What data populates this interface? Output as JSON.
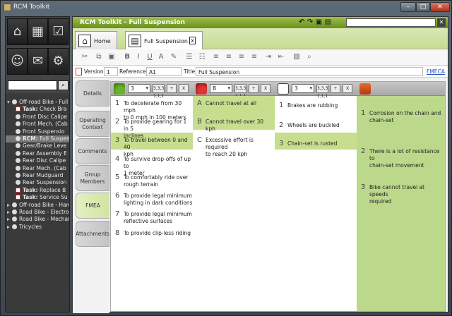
{
  "window": {
    "title": "RCM Toolkit"
  },
  "tree": [
    {
      "text": "Off-road Bike - Full S",
      "level": 0,
      "expanded": true,
      "icon": "gear-icon",
      "task": false
    },
    {
      "text": "Task: Check Bra",
      "level": 1,
      "icon": "task-icon",
      "task": true
    },
    {
      "text": "Front Disc Calipe",
      "level": 1,
      "icon": "gear-icon",
      "task": false
    },
    {
      "text": "Front Mech. (Cab",
      "level": 1,
      "icon": "gear-icon",
      "task": false
    },
    {
      "text": "Front Suspensio",
      "level": 1,
      "icon": "gear-icon",
      "task": false
    },
    {
      "text": "RCM: Full Suspen",
      "level": 1,
      "icon": "rcm-icon",
      "task": false,
      "selected": true
    },
    {
      "text": "Gear/Brake Leve",
      "level": 1,
      "icon": "gear-icon",
      "task": false
    },
    {
      "text": "Rear Assembly E",
      "level": 1,
      "icon": "gear-icon",
      "task": false
    },
    {
      "text": "Rear Disc Calipe",
      "level": 1,
      "icon": "gear-icon",
      "task": false
    },
    {
      "text": "Rear Mech. (Cab",
      "level": 1,
      "icon": "gear-icon",
      "task": false
    },
    {
      "text": "Rear Mudguard",
      "level": 1,
      "icon": "gear-icon",
      "task": false
    },
    {
      "text": "Rear Suspension",
      "level": 1,
      "icon": "gear-icon",
      "task": false
    },
    {
      "text": "Task: Replace B",
      "level": 1,
      "icon": "task-icon",
      "task": true
    },
    {
      "text": "Task: Service Su",
      "level": 1,
      "icon": "task-icon",
      "task": true
    },
    {
      "text": "Off-road Bike - Hardt",
      "level": 0,
      "expanded": false,
      "icon": "gear-icon",
      "task": false
    },
    {
      "text": "Road Bike - Electron",
      "level": 0,
      "expanded": false,
      "icon": "gear-icon",
      "task": false
    },
    {
      "text": "Road Bike - Mechan",
      "level": 0,
      "expanded": false,
      "icon": "gear-icon",
      "task": false
    },
    {
      "text": "Tricycles",
      "level": 0,
      "expanded": false,
      "icon": "gear-icon",
      "task": false
    }
  ],
  "main": {
    "title": "RCM Toolkit - Full Suspension"
  },
  "tabs": {
    "home": "Home",
    "fs": "Full Suspension",
    "close": "x"
  },
  "fields": {
    "version_label": "Version",
    "version": "1",
    "reference_label": "Reference",
    "reference": "A1",
    "title_label": "Title",
    "title": "Full Suspension",
    "fmeca": "FMECA"
  },
  "sidetabs": [
    "Details",
    "Operating Context",
    "Comments",
    "Group Members",
    "FMEA",
    "Attachments"
  ],
  "columns": [
    {
      "select": "3",
      "btn": "3,3,3 1,1,1"
    },
    {
      "select": "B",
      "btn": "3,3,3 1,1,1"
    },
    {
      "select": "3",
      "btn": "3,3,3 1,1,1"
    }
  ],
  "buttons": {
    "add": "+",
    "remove": "X"
  },
  "functions": [
    {
      "n": "1",
      "lines": [
        "To decelerate from 30 mph",
        "to 0 mph in 100 meters"
      ]
    },
    {
      "n": "2",
      "lines": [
        "To provide gearing for 1 in 5",
        "inclines"
      ]
    },
    {
      "n": "3",
      "lines": [
        "To travel between 0 and 40",
        "kph"
      ]
    },
    {
      "n": "4",
      "lines": [
        "To survive drop-offs of up to",
        "1 meter"
      ]
    },
    {
      "n": "5",
      "lines": [
        "To comfortably ride over",
        "rough terrain"
      ]
    },
    {
      "n": "6",
      "lines": [
        "To provide legal minimum",
        "lighting in dark conditions"
      ]
    },
    {
      "n": "7",
      "lines": [
        "To provide legal minimum",
        "reflective surfaces"
      ]
    },
    {
      "n": "8",
      "lines": [
        "To provide clip-less riding"
      ]
    }
  ],
  "failures": [
    {
      "n": "A",
      "lines": [
        "Cannot travel at all"
      ]
    },
    {
      "n": "B",
      "lines": [
        "Cannot travel over 30 kph"
      ]
    },
    {
      "n": "C",
      "lines": [
        "Excessive effort is required",
        "to reach 20 kph"
      ]
    }
  ],
  "modes": [
    {
      "n": "1",
      "lines": [
        "Brakes are rubbing"
      ]
    },
    {
      "n": "2",
      "lines": [
        "Wheels are buckled"
      ]
    },
    {
      "n": "3",
      "lines": [
        "Chain-set is rusted"
      ]
    }
  ],
  "effects": [
    {
      "n": "1",
      "lines": [
        "Corrosion on the chain and",
        "chain-set"
      ]
    },
    {
      "n": "2",
      "lines": [
        "There is a lot of resistance to",
        "chain-set movement"
      ]
    },
    {
      "n": "3",
      "lines": [
        "Bike cannot travel at speeds",
        "required"
      ]
    }
  ],
  "colors": {
    "accent": "#7fa52a",
    "selBand": "#c7de8f",
    "effectBg": "#bcd88a"
  }
}
